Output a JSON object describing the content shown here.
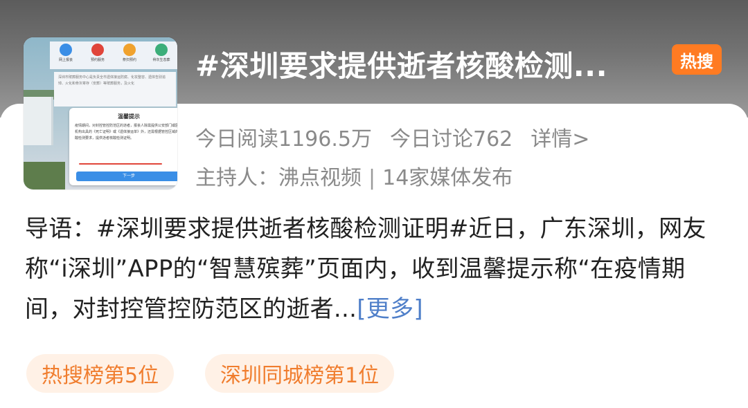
{
  "topic": {
    "title": "#深圳要求提供逝者核酸检测...",
    "badge": "热搜",
    "colors": {
      "badge": "#ff7b22",
      "tag_text": "#f07d2e",
      "link": "#4f7fc9"
    }
  },
  "stats": {
    "reads": "今日阅读1196.5万",
    "discussions": "今日讨论762",
    "details_link": "详情>"
  },
  "host": {
    "label": "主持人：沸点视频",
    "separator": "|",
    "media": "14家媒体发布"
  },
  "intro": {
    "text": "导语：#深圳要求提供逝者核酸检测证明#近日，广东深圳，网友称“i深圳”APP的“智慧殡葬”页面内，收到温馨提示称“在疫情期间，对封控管控防范区的逝者...",
    "more_link": "[更多]"
  },
  "tags": [
    "热搜榜第5位",
    "深圳同城榜第1位"
  ],
  "thumbnail": {
    "icons": [
      {
        "name": "clipboard-icon",
        "label": "网上报丧",
        "color": "#3a8ee6"
      },
      {
        "name": "cross-icon",
        "label": "预约服务",
        "color": "#e0453a"
      },
      {
        "name": "calendar-icon",
        "label": "祭扫预约",
        "color": "#f0a22e"
      },
      {
        "name": "leaf-icon",
        "label": "骨灰生态葬",
        "color": "#3cae7a"
      }
    ],
    "body_text": "深圳市殡葬服务中心是负责全市遗体接运防腐、化妆整容、遗体告别追悼、火化和骨灰寄存（安葬）等殡葬服务，及火化",
    "dialog_title": "温馨提示",
    "dialog_text": "疫情期间，对封控管控防范区的逝者，报丧人除需提供公安部门或医疗机构出具的《死亡证明》或《遗体接运单》外，还需根据管控区域的核酸检测要求，提供逝者核酸检测证明。",
    "dialog_button": "下一步"
  }
}
